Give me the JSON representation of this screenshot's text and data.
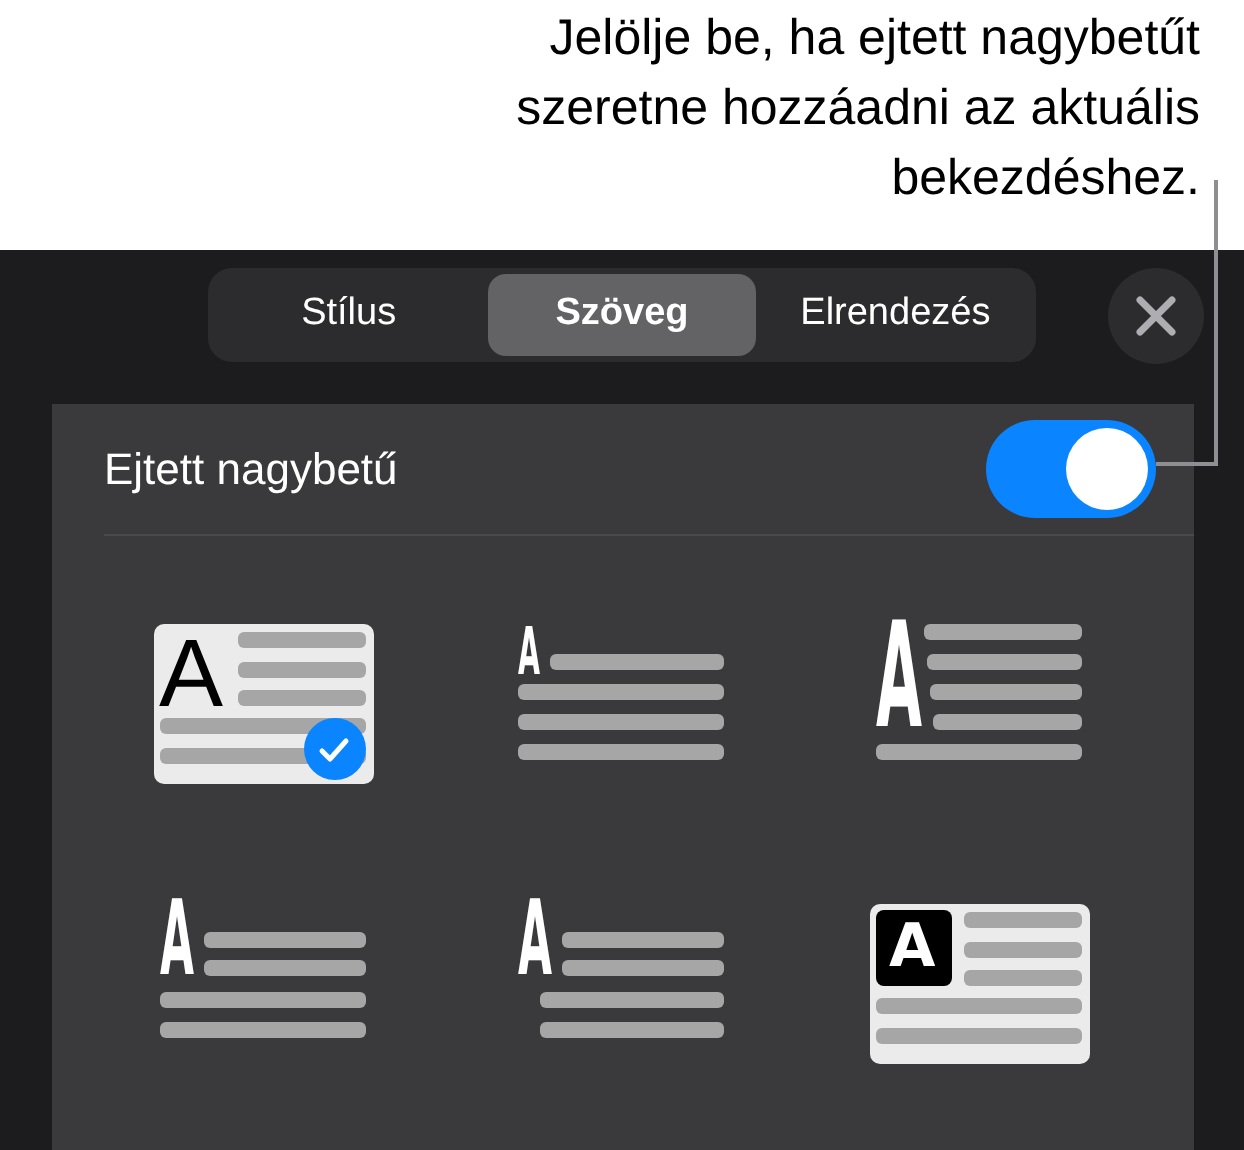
{
  "callout": {
    "text": "Jelölje be, ha ejtett nagybetűt szeretne hozzáadni az aktuális bekezdéshez."
  },
  "tabs": [
    {
      "label": "Stílus",
      "selected": false
    },
    {
      "label": "Szöveg",
      "selected": true
    },
    {
      "label": "Elrendezés",
      "selected": false
    }
  ],
  "drop_cap": {
    "label": "Ejtett nagybetű",
    "on": true
  },
  "styles": [
    {
      "kind": "inline-boxed",
      "letter": "A",
      "selected": true
    },
    {
      "kind": "raised",
      "letter": "A",
      "selected": false
    },
    {
      "kind": "dropped-4",
      "letter": "A",
      "selected": false
    },
    {
      "kind": "dropped-2",
      "letter": "A",
      "selected": false
    },
    {
      "kind": "dropped-2-indented",
      "letter": "A",
      "selected": false
    },
    {
      "kind": "inverse-boxed",
      "letter": "A",
      "selected": false
    }
  ]
}
